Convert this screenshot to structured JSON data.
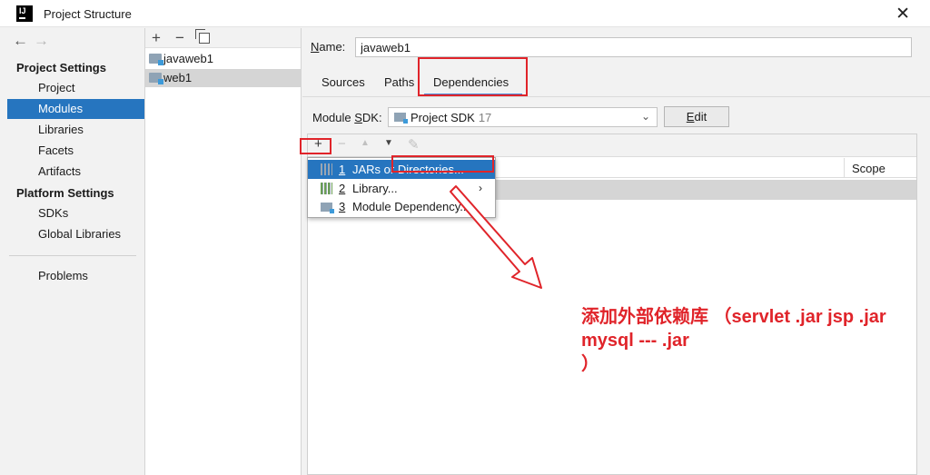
{
  "window": {
    "title": "Project Structure",
    "app_icon_text": "IJ",
    "close_glyph": "✕"
  },
  "nav": {
    "back_glyph": "←",
    "forward_glyph": "→"
  },
  "sidebar": {
    "project_settings_header": "Project Settings",
    "project_settings_items": [
      {
        "label": "Project"
      },
      {
        "label": "Modules",
        "selected": true
      },
      {
        "label": "Libraries"
      },
      {
        "label": "Facets"
      },
      {
        "label": "Artifacts"
      }
    ],
    "platform_settings_header": "Platform Settings",
    "platform_settings_items": [
      {
        "label": "SDKs"
      },
      {
        "label": "Global Libraries"
      }
    ],
    "problems_label": "Problems"
  },
  "modules_panel": {
    "toolbar": {
      "add": "+",
      "remove": "−"
    },
    "modules": [
      {
        "name": "javaweb1",
        "selected": false
      },
      {
        "name": "web1",
        "selected": true
      }
    ]
  },
  "module_detail": {
    "name_label_prefix": "N",
    "name_label_rest": "ame:",
    "name_value": "javaweb1",
    "tabs": [
      {
        "label": "Sources"
      },
      {
        "label": "Paths"
      },
      {
        "label": "Dependencies",
        "active": true
      }
    ],
    "sdk_label_prefix": "Module ",
    "sdk_label_mnemonic": "S",
    "sdk_label_rest": "DK:",
    "sdk_value": "Project SDK",
    "sdk_version": "17",
    "edit_button_mnemonic": "E",
    "edit_button_rest": "dit",
    "dependencies_toolbar": {
      "add": "+",
      "remove": "−",
      "up": "▲",
      "down": "▼",
      "edit": "✎"
    },
    "scope_header": "Scope"
  },
  "add_menu": {
    "items": [
      {
        "number": "1",
        "label": "JARs or Directories...",
        "icon": "jar-icon",
        "selected": true
      },
      {
        "number": "2",
        "label": "Library...",
        "icon": "library-icon",
        "has_submenu": true
      },
      {
        "number": "3",
        "label": "Module Dependency...",
        "icon": "module-icon"
      }
    ],
    "submenu_arrow": "›"
  },
  "annotation": {
    "line1": "添加外部依赖库 （servlet .jar jsp .jar",
    "line2": "mysql --- .jar",
    "line3": "）",
    "color": "#e0242a"
  }
}
